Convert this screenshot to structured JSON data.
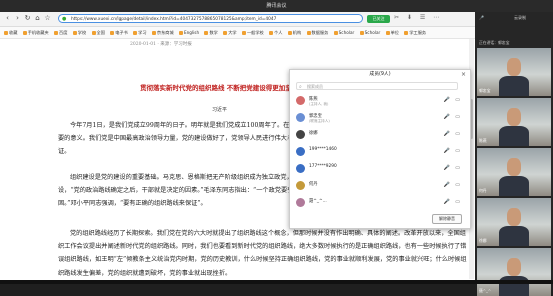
{
  "window_title": "腾讯会议",
  "browser": {
    "url": "https://www.xuexi.cn/lgpage/detail/index.html?id=4047327578865078125&amp;item_id=4047",
    "bookmarks": [
      "收藏",
      "手机收藏夹",
      "百度",
      "学校",
      "全国",
      "电子书",
      "学习",
      "京东商城",
      "English",
      "数学",
      "大学",
      "一般学校",
      "个人",
      "机构",
      "数据服务",
      "Scholar",
      "Scholar",
      "单位",
      "学工服务"
    ],
    "green_button": "已关注"
  },
  "article": {
    "crumb": "2020-01-01  · 来源：学习时报",
    "title": "贯彻落实新时代党的组织路线 不断把党建设得更加坚强有力",
    "author": "习近平",
    "paragraphs": [
      "今年7月1日，是我们党成立99周年的日子。明年就是我们党成立100周年了。在这个重要时间节点上，我们强调做好党的建设工作，具有十分重要的意义。我们党是中国最高政治领导力量，党的建设做好了，党领导人民进行伟大斗争、建设伟大工程、推进伟大事业、实现伟大梦想就有了根本保证。",
      "组织建设是党的建设的重要基础。马克思、恩格斯把无产阶级组织成为独立政党，列宁强调党是无产阶级的先锋队。我们党历来重视组织建设，“党的政治路线确定之后，干部就是决定的因素。”毛泽东同志指出：“一个政党要引导革命到胜利，必须依靠自己政治路线的正确和组织上的巩固。”邓小平同志强调，“要有正确的组织路线来保证”。",
      "党的组织路线经历了长期探索。我们党在党的六大时就提出了组织路线这个概念，但那时候并没有作出明确、具体的阐述。改革开放以来，全国组织工作会议提出并阐述新时代党的组织路线。同时，我们也要看到新时代党的组织路线，绝大多数时候执行的是正确组织路线，也有一些时候执行了错误组织路线，如王明“左”倾教条主义统治党内时期，党的历史教训，什么时候坚持正确组织路线，党的事业就顺利发展，党的事业就兴旺；什么时候组织路线发生偏差，党的组织就遭到破坏，党的事业就出现挫折。"
    ]
  },
  "member_panel": {
    "title": "成员(9人)",
    "search_placeholder": "搜索成员",
    "members": [
      {
        "name": "陈燕",
        "sub": "(主持人, 我)",
        "color": "#d46a6a"
      },
      {
        "name": "郭忠宝",
        "sub": "(联席主持人)",
        "color": "#6a8fd4"
      },
      {
        "name": "徐娜",
        "sub": "",
        "color": "#444"
      },
      {
        "name": "199****1460",
        "sub": "",
        "color": "#3a6ec4"
      },
      {
        "name": "177****9290",
        "sub": "",
        "color": "#3a6ec4"
      },
      {
        "name": "何丹",
        "sub": "",
        "color": "#c49a3a"
      },
      {
        "name": "聂^_^...",
        "sub": "",
        "color": "#b07a9a"
      }
    ],
    "unmute_all": "解除静音"
  },
  "meeting": {
    "top_label": "正在讲话：郭忠宝",
    "rec_label": "云录制",
    "tiles": [
      {
        "name": "郭忠宝"
      },
      {
        "name": "陈燕"
      },
      {
        "name": "何丹"
      },
      {
        "name": "徐娜"
      },
      {
        "name": "聂^_^"
      }
    ]
  }
}
